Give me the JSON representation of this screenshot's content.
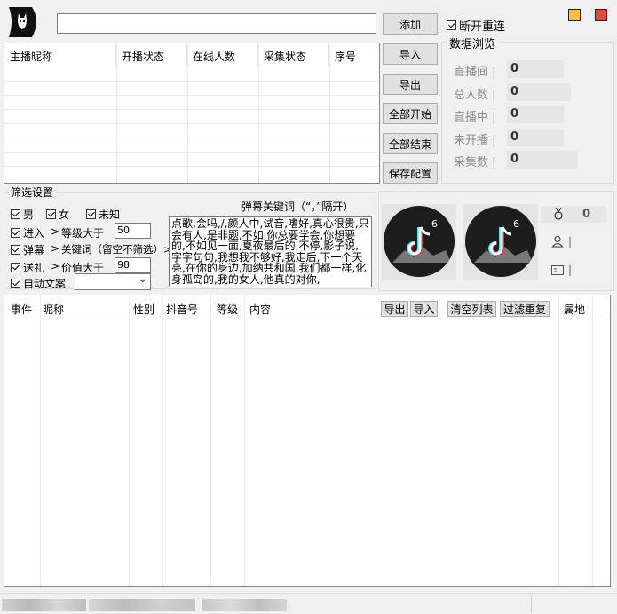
{
  "top": {
    "add_label": "添加",
    "reconnect_label": "断开重连",
    "reconnect_checked": true,
    "url_value": ""
  },
  "window_colors": {
    "minimize": "#f5c242",
    "close": "#e8453c"
  },
  "streamer_table": {
    "columns": [
      "主播昵称",
      "开播状态",
      "在线人数",
      "采集状态",
      "序号"
    ]
  },
  "side_buttons": {
    "import_label": "导入",
    "export_label": "导出",
    "start_all_label": "全部开始",
    "stop_all_label": "全部结束",
    "save_config_label": "保存配置"
  },
  "stats": {
    "title": "数据浏览",
    "items": [
      {
        "label": "直播间",
        "value": "0"
      },
      {
        "label": "总人数",
        "value": "0"
      },
      {
        "label": "直播中",
        "value": "0"
      },
      {
        "label": "未开播",
        "value": "0"
      },
      {
        "label": "采集数",
        "value": "0"
      }
    ]
  },
  "filter": {
    "title": "筛选设置",
    "gender": [
      {
        "label": "男",
        "checked": true
      },
      {
        "label": "女",
        "checked": true
      },
      {
        "label": "未知",
        "checked": true
      }
    ],
    "enter_label": "进入",
    "enter_checked": true,
    "level_label": "等级大于",
    "level_value": "50",
    "danmu_label": "弹幕",
    "danmu_checked": true,
    "keyword_label": "关键词（留空不筛选）>",
    "gift_label": "送礼",
    "gift_checked": true,
    "value_label": "价值大于",
    "value_value": "98",
    "auto_label": "自动文案",
    "auto_checked": true,
    "auto_select_value": ""
  },
  "keywords": {
    "title": "弹幕关键词（“，”隔开）",
    "text": "点歌,会吗,/,颜人中,试音,嗜好,真心很贵,只会有人,是非题,不如,你总要学会,你想要的,不如见一面,夏夜最后的,不停,影子说,字字句句,我想我不够好,我走后,下一个天亮,在你的身边,加纳共和国,我们都一样,化身孤岛的,我的女人,他真的对你,"
  },
  "profile": {
    "rank_value": "0",
    "user_value": "",
    "id_value": ""
  },
  "events_table": {
    "columns": [
      "事件",
      "昵称",
      "性别",
      "抖音号",
      "等级",
      "内容",
      "属地"
    ],
    "export_label": "导出",
    "import_label": "导入",
    "clear_label": "清空列表",
    "dedupe_label": "过滤重复"
  }
}
